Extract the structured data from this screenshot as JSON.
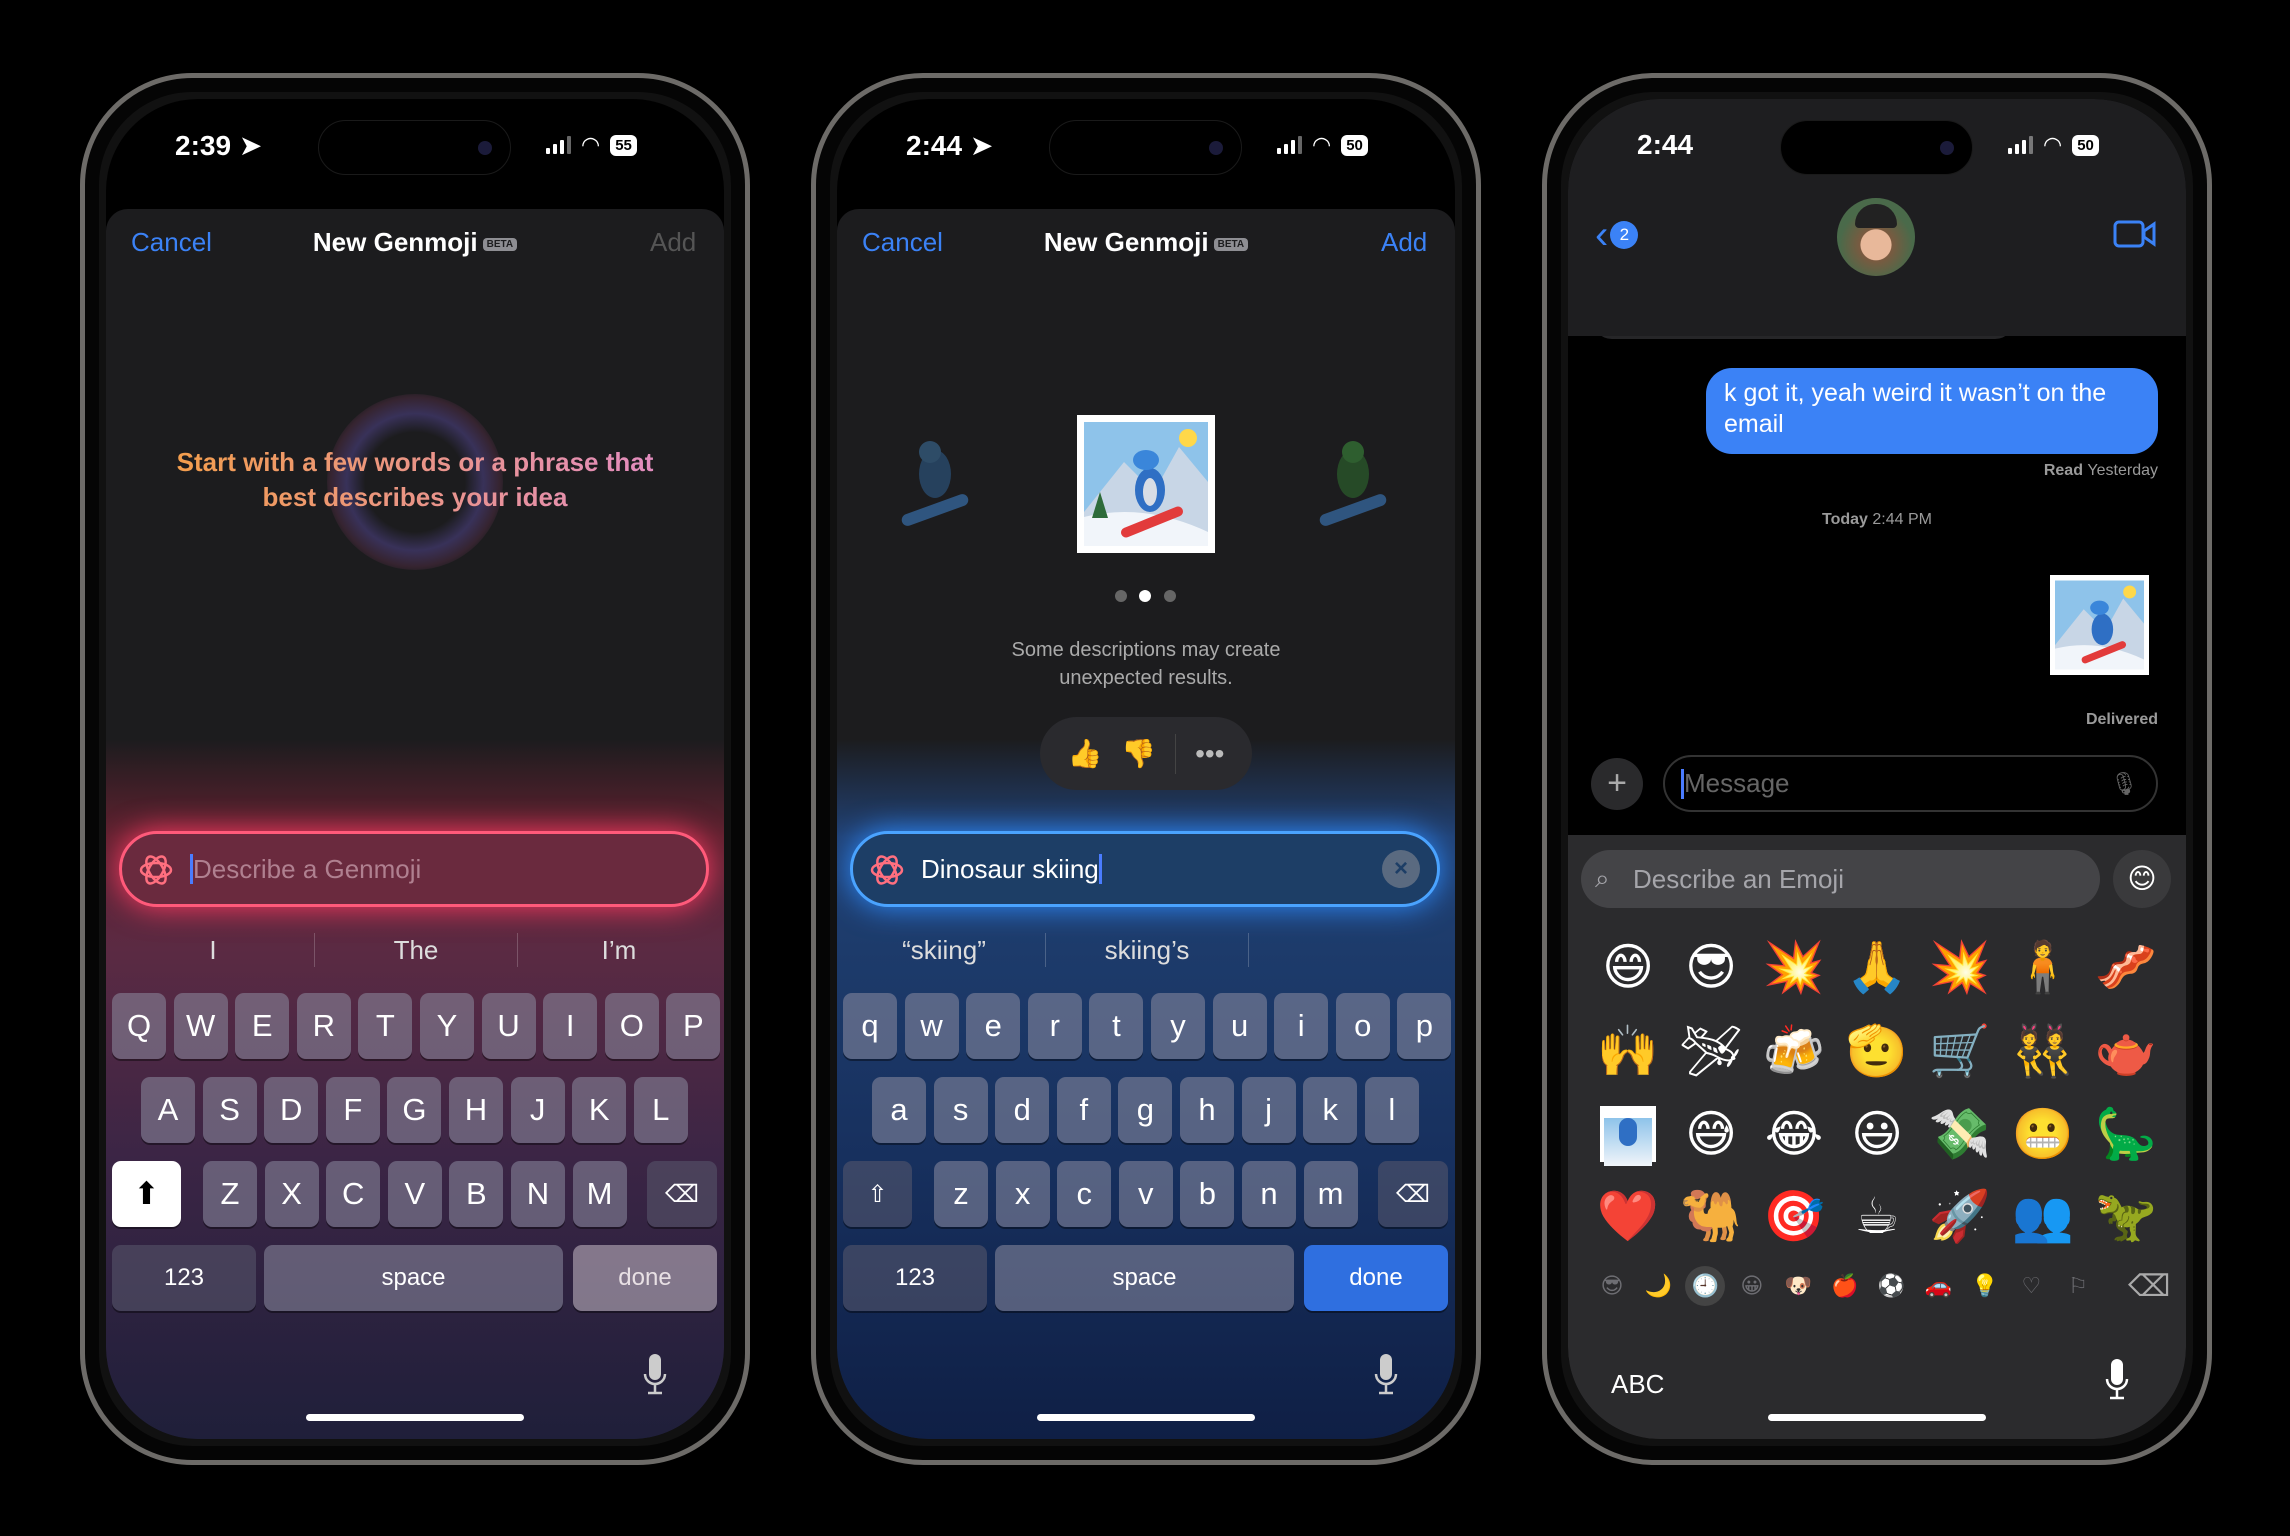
{
  "colors": {
    "accent": "#3b82f6",
    "bubble": "#3b82f6",
    "glow_phone1": "#ff3b63",
    "glow_phone2": "#2d8cff"
  },
  "phone1": {
    "status": {
      "time": "2:39",
      "battery": "55",
      "location_icon": "location-arrow-icon"
    },
    "nav": {
      "cancel": "Cancel",
      "title": "New Genmoji",
      "beta": "BETA",
      "add": "Add"
    },
    "prompt": {
      "line1": "Start with a few words or a phrase that",
      "line2": "best describes your idea"
    },
    "input": {
      "placeholder": "Describe a Genmoji",
      "value": ""
    },
    "suggestions": [
      "I",
      "The",
      "I’m"
    ],
    "keyboard": {
      "row1": [
        "Q",
        "W",
        "E",
        "R",
        "T",
        "Y",
        "U",
        "I",
        "O",
        "P"
      ],
      "row2": [
        "A",
        "S",
        "D",
        "F",
        "G",
        "H",
        "J",
        "K",
        "L"
      ],
      "row3": [
        "Z",
        "X",
        "C",
        "V",
        "B",
        "N",
        "M"
      ],
      "numbers": "123",
      "space": "space",
      "done": "done"
    }
  },
  "phone2": {
    "status": {
      "time": "2:44",
      "battery": "50"
    },
    "nav": {
      "cancel": "Cancel",
      "title": "New Genmoji",
      "beta": "BETA",
      "add": "Add"
    },
    "carousel": {
      "pages": 3,
      "current": 2
    },
    "note": {
      "line1": "Some descriptions may create",
      "line2": "unexpected results."
    },
    "feedback": {
      "thumbs_up": "👍",
      "thumbs_down": "👎",
      "more": "•••"
    },
    "input": {
      "value": "Dinosaur skiing"
    },
    "suggestions": [
      "“skiing”",
      "skiing’s",
      ""
    ],
    "keyboard": {
      "row1": [
        "q",
        "w",
        "e",
        "r",
        "t",
        "y",
        "u",
        "i",
        "o",
        "p"
      ],
      "row2": [
        "a",
        "s",
        "d",
        "f",
        "g",
        "h",
        "j",
        "k",
        "l"
      ],
      "row3": [
        "z",
        "x",
        "c",
        "v",
        "b",
        "n",
        "m"
      ],
      "numbers": "123",
      "space": "space",
      "done": "done"
    }
  },
  "phone3": {
    "status": {
      "time": "2:44",
      "battery": "50"
    },
    "header": {
      "back_badge": "2"
    },
    "messages": {
      "sent_text": "k got it, yeah weird it wasn’t on the email",
      "read_label": "Read",
      "read_time": "Yesterday",
      "timestamp_day": "Today",
      "timestamp_time": "2:44 PM",
      "delivered": "Delivered"
    },
    "composer": {
      "placeholder": "Message"
    },
    "emoji_keyboard": {
      "search_placeholder": "Describe an Emoji",
      "rows": [
        [
          "😄",
          "😎",
          "💥",
          "🙏",
          "💥",
          "🧍",
          "🥓"
        ],
        [
          "🙌",
          "🛩",
          "🍻",
          "🫡",
          "🛒",
          "👯",
          "🫖"
        ],
        [
          "[genmoji]",
          "😅",
          "😂",
          "😃",
          "💸",
          "😬",
          "🦕"
        ],
        [
          "❤️",
          "🐫",
          "🎯",
          "☕",
          "🚀",
          "👥",
          "🦖"
        ]
      ],
      "categories": [
        "😎",
        "🌙",
        "🕘",
        "😀",
        "🐶",
        "🍎",
        "⚽",
        "🚗",
        "💡",
        "♡",
        "⚐"
      ],
      "active_category": 2,
      "abc": "ABC"
    }
  }
}
